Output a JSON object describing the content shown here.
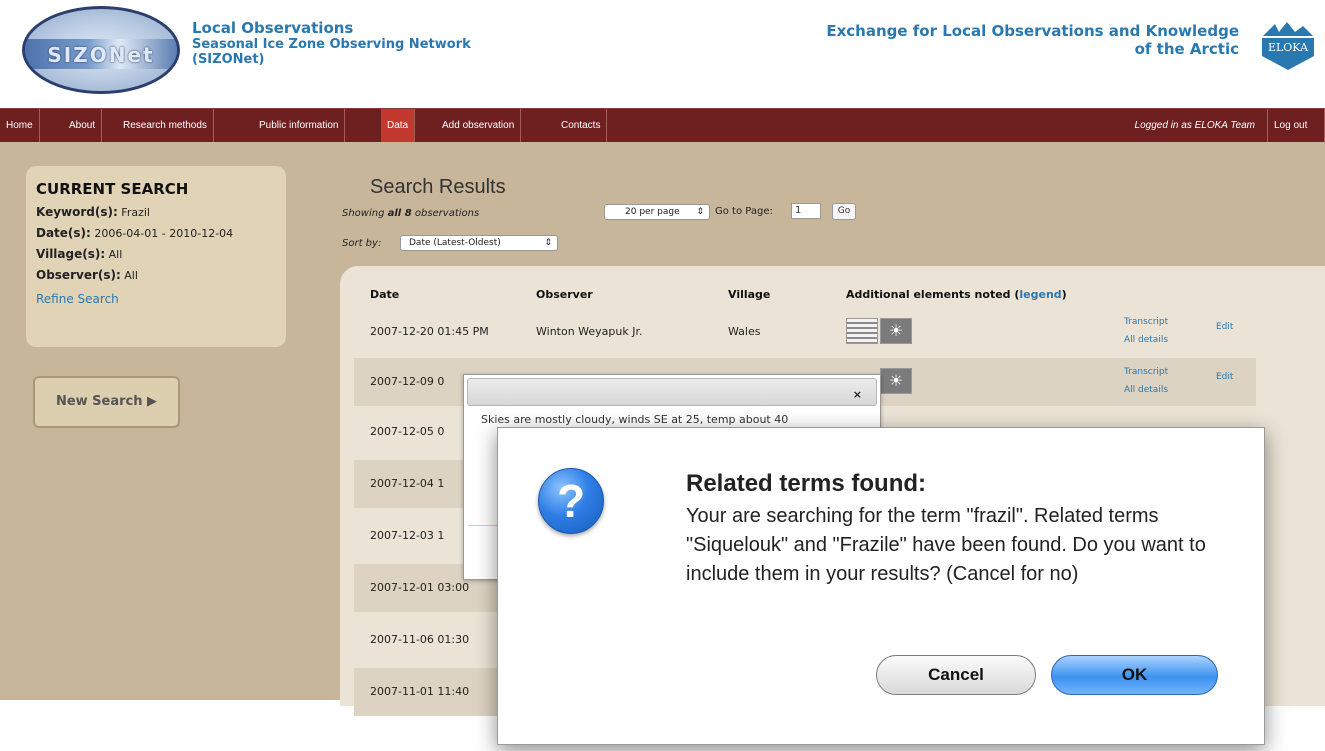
{
  "header": {
    "logo_text": "SIZONet",
    "title_line1": "Local Observations",
    "title_line2": "Seasonal Ice Zone Observing Network",
    "title_line3": "(SIZONet)",
    "eloka_title_line1": "Exchange for Local Observations and Knowledge",
    "eloka_title_line2": "of the Arctic",
    "eloka_logo_text": "ELOKA"
  },
  "nav": {
    "items": [
      "Home",
      "About",
      "Research methods",
      "Public information",
      "Data",
      "Add observation",
      "Contacts"
    ],
    "active": "Data",
    "logged_in": "Logged in as ELOKA Team",
    "logout": "Log out"
  },
  "current_search": {
    "title": "CURRENT SEARCH",
    "keyword_label": "Keyword(s):",
    "keyword_value": "Frazil",
    "date_label": "Date(s):",
    "date_value": "2006-04-01 - 2010-12-04",
    "village_label": "Village(s):",
    "village_value": "All",
    "observer_label": "Observer(s):",
    "observer_value": "All",
    "refine": "Refine Search"
  },
  "new_search": "New Search ▶",
  "results": {
    "title": "Search Results",
    "showing_prefix": "Showing ",
    "showing_count": "all 8",
    "showing_suffix": " observations",
    "per_page": "20 per page",
    "goto_label": "Go to Page:",
    "goto_value": "1",
    "go": "Go",
    "sortby_label": "Sort by:",
    "sort_value": "Date (Latest-Oldest)",
    "columns": {
      "date": "Date",
      "observer": "Observer",
      "village": "Village",
      "additional": "Additional elements noted (",
      "legend": "legend",
      "additional_close": ")"
    },
    "rows": [
      {
        "date": "2007-12-20 01:45 PM",
        "observer": "Winton Weyapuk Jr.",
        "village": "Wales",
        "transcript": "Transcript",
        "details": "All details",
        "edit": "Edit"
      },
      {
        "date": "2007-12-09 0",
        "transcript": "Transcript",
        "details": "All details",
        "edit": "Edit"
      },
      {
        "date": "2007-12-05 0"
      },
      {
        "date": "2007-12-04 1"
      },
      {
        "date": "2007-12-03 1"
      },
      {
        "date": "2007-12-01 03:00"
      },
      {
        "date": "2007-11-06 01:30"
      },
      {
        "date": "2007-11-01 11:40"
      }
    ]
  },
  "tooltip": {
    "close": "×",
    "text": "Skies are mostly cloudy, winds SE at 25, temp about 40"
  },
  "dialog": {
    "icon": "?",
    "title": "Related terms found:",
    "message": "Your are searching for the term \"frazil\".  Related terms \"Siquelouk\" and \"Frazile\" have been found.  Do you want to include them in your results? (Cancel for no)",
    "cancel": "Cancel",
    "ok": "OK"
  }
}
